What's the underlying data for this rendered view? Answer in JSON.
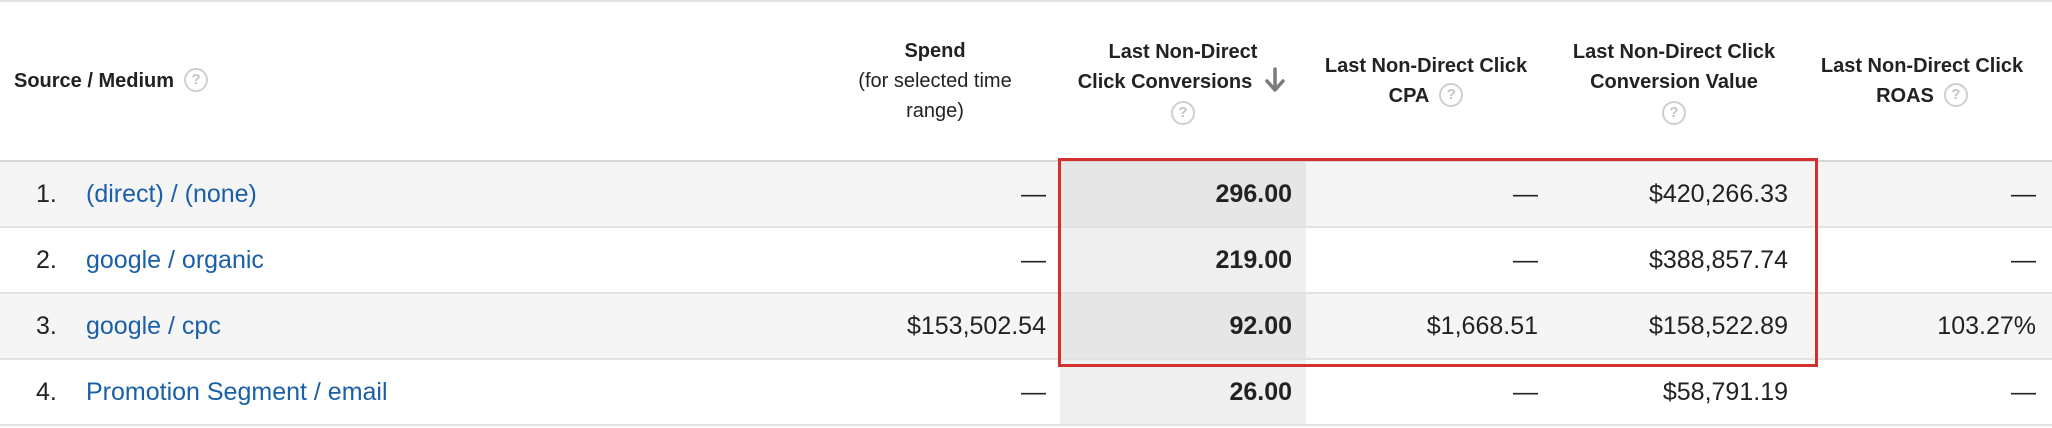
{
  "headers": {
    "source_medium": "Source / Medium",
    "spend_title": "Spend",
    "spend_sub_1": "(for selected time",
    "spend_sub_2": "range)",
    "conversions_1": "Last Non-Direct",
    "conversions_2": "Click Conversions",
    "cpa_1": "Last Non-Direct Click",
    "cpa_2": "CPA",
    "value_1": "Last Non-Direct Click",
    "value_2": "Conversion Value",
    "roas_1": "Last Non-Direct Click",
    "roas_2": "ROAS",
    "help_glyph": "?"
  },
  "sort": {
    "column": "Last Non-Direct Click Conversions",
    "direction": "descending",
    "icon": "arrow-down-icon"
  },
  "rows": [
    {
      "index": "1.",
      "source": "(direct) / (none)",
      "spend": "—",
      "conversions": "296.00",
      "cpa": "—",
      "value": "$420,266.33",
      "roas": "—"
    },
    {
      "index": "2.",
      "source": "google / organic",
      "spend": "—",
      "conversions": "219.00",
      "cpa": "—",
      "value": "$388,857.74",
      "roas": "—"
    },
    {
      "index": "3.",
      "source": "google / cpc",
      "spend": "$153,502.54",
      "conversions": "92.00",
      "cpa": "$1,668.51",
      "value": "$158,522.89",
      "roas": "103.27%"
    },
    {
      "index": "4.",
      "source": "Promotion Segment / email",
      "spend": "—",
      "conversions": "26.00",
      "cpa": "—",
      "value": "$58,791.19",
      "roas": "—"
    }
  ],
  "colors": {
    "link": "#1a5fa8",
    "highlight_border": "#d32f2f",
    "sorted_column_bg": "#e6e6e6"
  }
}
